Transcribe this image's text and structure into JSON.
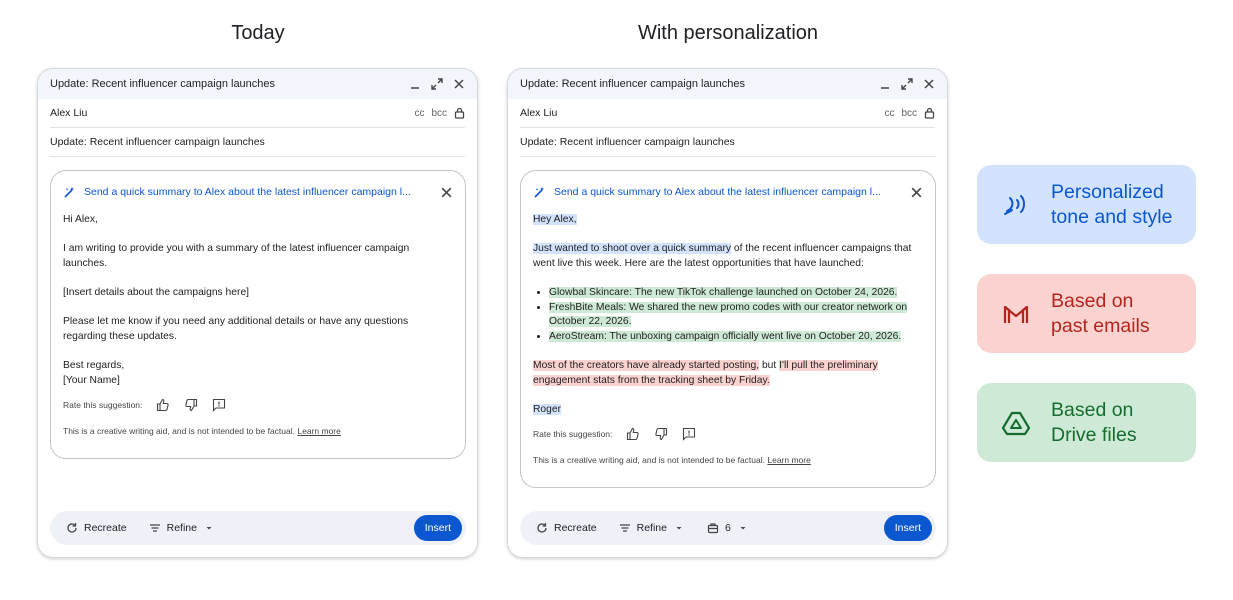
{
  "headings": {
    "left": "Today",
    "right": "With personalization"
  },
  "common": {
    "window_title": "Update: Recent influencer campaign launches",
    "to": "Alex Liu",
    "cc": "cc",
    "bcc": "bcc",
    "subject": "Update: Recent influencer campaign launches",
    "prompt": "Send a quick summary to Alex about the latest influencer campaign l...",
    "rate_label": "Rate this suggestion:",
    "disclaimer": "This is a creative writing aid, and is not intended to be factual.",
    "learn_more": "Learn more",
    "recreate": "Recreate",
    "refine": "Refine",
    "insert": "Insert"
  },
  "today": {
    "greeting": "Hi Alex,",
    "para1": "I am writing to provide you with a summary of the latest influencer campaign launches.",
    "para2": "[Insert details about the campaigns here]",
    "para3": "Please let me know if you need any additional details or have any questions regarding these updates.",
    "closing": "Best regards,",
    "signature": "[Your Name]"
  },
  "personalized": {
    "greeting": "Hey Alex,",
    "intro_hl": "Just wanted to shoot over a quick summary",
    "intro_rest": " of the recent influencer campaigns that went live this week. Here are the latest opportunities that have launched:",
    "bullets": [
      "Glowbal Skincare: The new TikTok challenge launched on October 24, 2026.",
      "FreshBite Meals: We shared the new promo codes with our creator network on October 22, 2026.",
      "AeroStream: The unboxing campaign officially went live on October 20, 2026."
    ],
    "outro_hl1": "Most of the creators have already started posting,",
    "outro_mid": " but ",
    "outro_hl2": "I'll pull the preliminary engagement stats from the tracking sheet by Friday.",
    "signature": "Roger",
    "tone_count": "6"
  },
  "features": [
    {
      "label": "Personalized\ntone and style",
      "bg": "#d3e3fd",
      "fg": "#0b57d0",
      "icon": "voice-waves-icon"
    },
    {
      "label": "Based on\npast emails",
      "bg": "#fad2cf",
      "fg": "#b3261e",
      "icon": "gmail-icon"
    },
    {
      "label": "Based on\nDrive files",
      "bg": "#ceead6",
      "fg": "#146c2e",
      "icon": "drive-icon"
    }
  ]
}
